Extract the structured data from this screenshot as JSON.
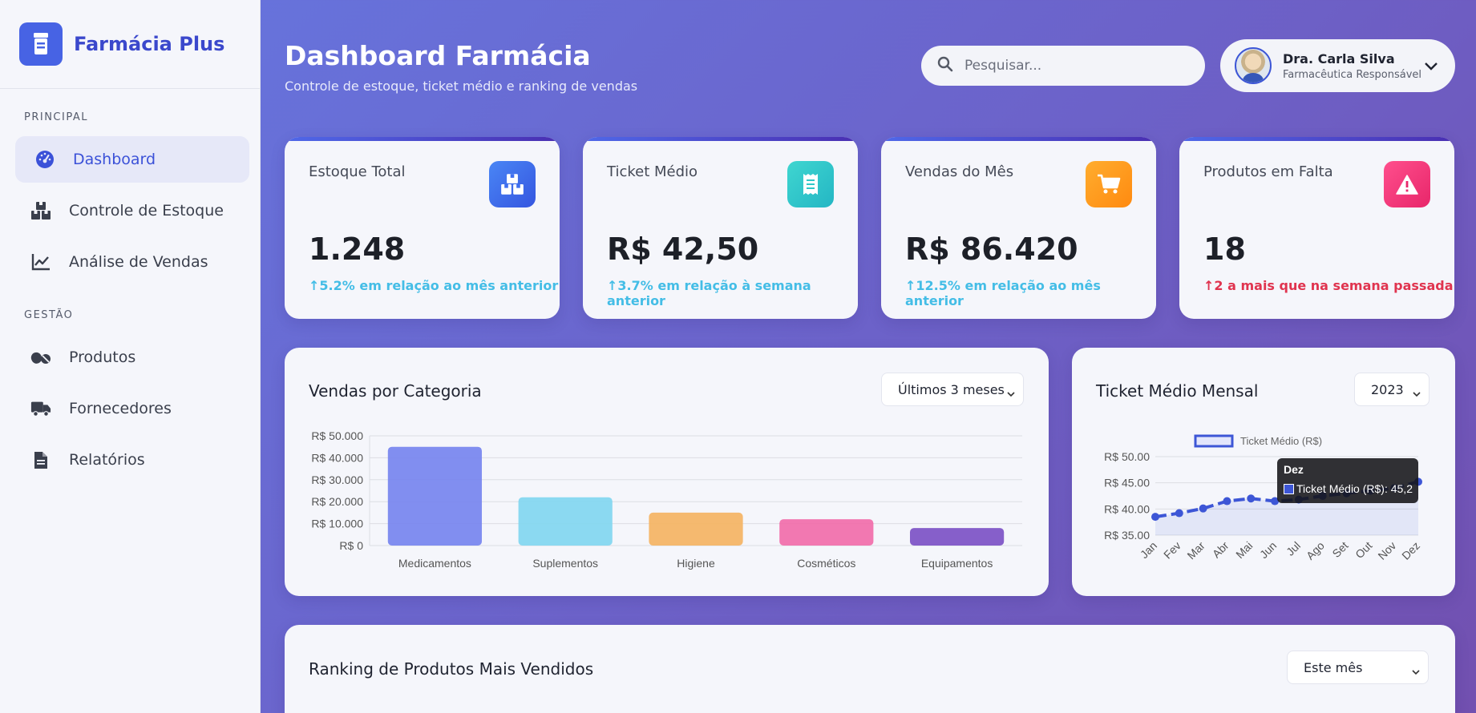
{
  "brand": {
    "name": "Farmácia Plus",
    "icon": "pill-bottle-icon"
  },
  "sidebar": {
    "sections": [
      {
        "title": "PRINCIPAL",
        "items": [
          {
            "label": "Dashboard",
            "icon": "gauge-icon",
            "active": true
          },
          {
            "label": "Controle de Estoque",
            "icon": "boxes-icon"
          },
          {
            "label": "Análise de Vendas",
            "icon": "line-chart-icon"
          }
        ]
      },
      {
        "title": "GESTÃO",
        "items": [
          {
            "label": "Produtos",
            "icon": "capsules-icon"
          },
          {
            "label": "Fornecedores",
            "icon": "truck-icon"
          },
          {
            "label": "Relatórios",
            "icon": "file-icon"
          }
        ]
      }
    ]
  },
  "header": {
    "title": "Dashboard Farmácia",
    "subtitle": "Controle de estoque, ticket médio e ranking de vendas",
    "search_placeholder": "Pesquisar...",
    "user": {
      "name": "Dra. Carla Silva",
      "role": "Farmacêutica Responsável"
    }
  },
  "stats": [
    {
      "label": "Estoque Total",
      "value": "1.248",
      "change": "5.2% em relação ao mês anterior",
      "direction": "up",
      "icon": "boxes-icon",
      "icon_color": "#3f6ff0"
    },
    {
      "label": "Ticket Médio",
      "value": "R$ 42,50",
      "change": "3.7% em relação à semana anterior",
      "direction": "up",
      "icon": "receipt-icon",
      "icon_color": "#2ec8c8"
    },
    {
      "label": "Vendas do Mês",
      "value": "R$ 86.420",
      "change": "12.5% em relação ao mês anterior",
      "direction": "up",
      "icon": "cart-icon",
      "icon_color": "#ff9a1a"
    },
    {
      "label": "Produtos em Falta",
      "value": "18",
      "change": "2 a mais que na semana passada",
      "direction": "down",
      "icon": "warning-icon",
      "icon_color": "#f0306e"
    }
  ],
  "sales_panel": {
    "title": "Vendas por Categoria",
    "period": "Últimos 3 meses"
  },
  "ticket_panel": {
    "title": "Ticket Médio Mensal",
    "year": "2023"
  },
  "ranking_panel": {
    "title": "Ranking de Produtos Mais Vendidos",
    "period": "Este mês"
  },
  "chart_data": [
    {
      "type": "bar",
      "title": "Vendas por Categoria",
      "categories": [
        "Medicamentos",
        "Suplementos",
        "Higiene",
        "Cosméticos",
        "Equipamentos"
      ],
      "values": [
        45000,
        22000,
        15000,
        12000,
        8000
      ],
      "colors": [
        "#7483ee",
        "#7fd6f0",
        "#f5b25f",
        "#f26aa8",
        "#7a4fc4"
      ],
      "ylim": [
        0,
        50000
      ],
      "yticks": [
        "R$ 0",
        "R$ 10.000",
        "R$ 20.000",
        "R$ 30.000",
        "R$ 40.000",
        "R$ 50.000"
      ],
      "grid": true
    },
    {
      "type": "line",
      "title": "Ticket Médio Mensal",
      "x": [
        "Jan",
        "Fev",
        "Mar",
        "Abr",
        "Mai",
        "Jun",
        "Jul",
        "Ago",
        "Set",
        "Out",
        "Nov",
        "Dez"
      ],
      "series": [
        {
          "name": "Ticket Médio (R$)",
          "values": [
            38.5,
            39.2,
            40.1,
            41.5,
            42.0,
            41.5,
            41.8,
            42.5,
            43.0,
            43.5,
            44.0,
            45.2
          ],
          "color": "#3d56d6"
        }
      ],
      "ylim": [
        35,
        50
      ],
      "yticks": [
        "R$ 35.00",
        "R$ 40.00",
        "R$ 45.00",
        "R$ 50.00"
      ],
      "legend": "top",
      "tooltip": {
        "title": "Dez",
        "text": "Ticket Médio (R$): 45,2"
      }
    }
  ]
}
